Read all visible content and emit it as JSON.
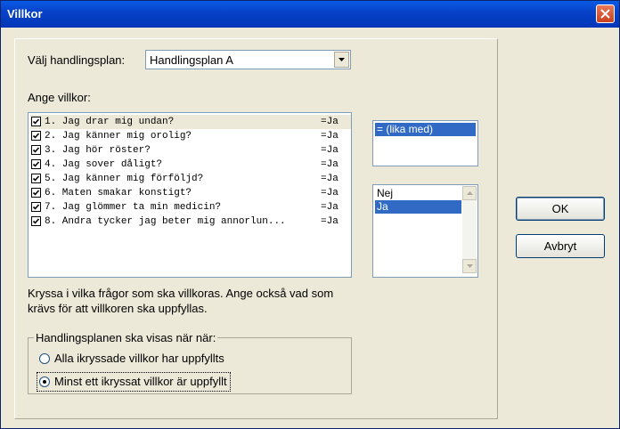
{
  "window": {
    "title": "Villkor"
  },
  "plan": {
    "label": "Välj handlingsplan:",
    "selected": "Handlingsplan A"
  },
  "conditions": {
    "label": "Ange villkor:",
    "items": [
      {
        "text": "1. Jag drar mig undan?",
        "value": "=Ja",
        "checked": true
      },
      {
        "text": "2. Jag känner mig orolig?",
        "value": "=Ja",
        "checked": true
      },
      {
        "text": "3. Jag hör röster?",
        "value": "=Ja",
        "checked": true
      },
      {
        "text": "4. Jag sover dåligt?",
        "value": "=Ja",
        "checked": true
      },
      {
        "text": "5. Jag känner mig förföljd?",
        "value": "=Ja",
        "checked": true
      },
      {
        "text": "6. Maten smakar konstigt?",
        "value": "=Ja",
        "checked": true
      },
      {
        "text": "7. Jag glömmer ta min medicin?",
        "value": "=Ja",
        "checked": true
      },
      {
        "text": "8. Andra tycker jag beter mig annorlun...",
        "value": "=Ja",
        "checked": true
      }
    ]
  },
  "operator": {
    "options": [
      "= (lika med)"
    ],
    "selected": 0
  },
  "answers": {
    "options": [
      "Nej",
      "Ja"
    ],
    "selected": 1
  },
  "buttons": {
    "ok": "OK",
    "cancel": "Avbryt"
  },
  "help": {
    "line1": "Kryssa i vilka frågor som ska villkoras. Ange också vad som",
    "line2": "krävs för att villkoren ska uppfyllas."
  },
  "group": {
    "title": "Handlingsplanen ska visas när när:",
    "option_all": "Alla ikryssade villkor har uppfyllts",
    "option_any": "Minst ett ikryssat villkor är uppfyllt",
    "selected": "any"
  }
}
